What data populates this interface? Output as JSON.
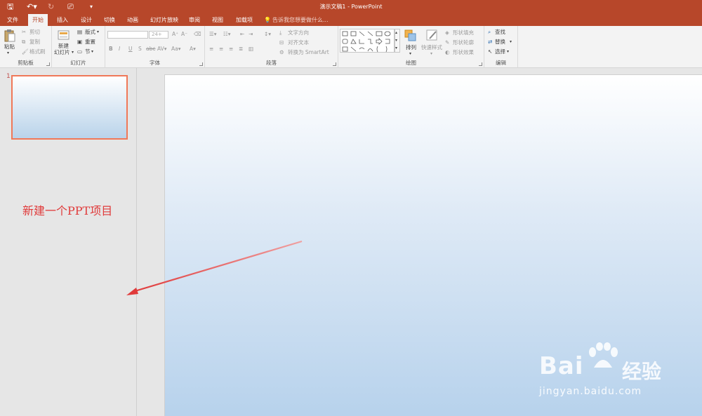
{
  "window": {
    "title": "演示文稿1 - PowerPoint"
  },
  "tabs": [
    {
      "label": "文件"
    },
    {
      "label": "开始"
    },
    {
      "label": "插入"
    },
    {
      "label": "设计"
    },
    {
      "label": "切换"
    },
    {
      "label": "动画"
    },
    {
      "label": "幻灯片放映"
    },
    {
      "label": "审阅"
    },
    {
      "label": "视图"
    },
    {
      "label": "加载项"
    }
  ],
  "tell_me": "告诉我您想要做什么...",
  "ribbon": {
    "clipboard": {
      "label": "剪贴板",
      "paste": "粘贴",
      "cut": "剪切",
      "copy": "复制",
      "format_painter": "格式刷"
    },
    "slides": {
      "label": "幻灯片",
      "new_slide_1": "新建",
      "new_slide_2": "幻灯片",
      "layout": "版式",
      "reset": "重置",
      "section": "节"
    },
    "font": {
      "label": "字体",
      "font_size": "24+"
    },
    "paragraph": {
      "label": "段落",
      "text_direction": "文字方向",
      "align_text": "对齐文本",
      "smartart": "转换为 SmartArt"
    },
    "drawing": {
      "label": "绘图",
      "arrange": "排列",
      "quick_styles": "快速样式",
      "shape_fill": "形状填充",
      "shape_outline": "形状轮廓",
      "shape_effects": "形状效果"
    },
    "editing": {
      "label": "编辑",
      "find": "查找",
      "replace": "替换",
      "select": "选择"
    }
  },
  "thumbnails": [
    {
      "number": "1"
    }
  ],
  "annotation": "新建一个PPT项目",
  "watermark": {
    "brand": "Bai",
    "brand_cn": "经验",
    "url": "jingyan.baidu.com"
  },
  "colors": {
    "accent": "#b7472a",
    "annotation": "#e03a3a",
    "thumb_border": "#f07858"
  }
}
